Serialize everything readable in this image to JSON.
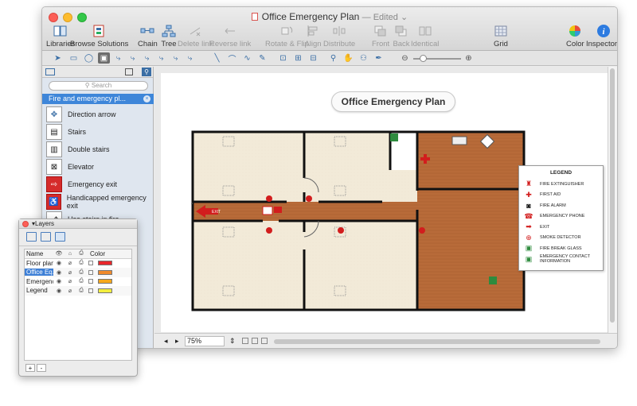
{
  "window": {
    "title": "Office Emergency Plan",
    "status": "Edited",
    "status_caret": "⌄"
  },
  "toolbar": [
    {
      "label": "Libraries",
      "icon": "libraries-icon",
      "enabled": true
    },
    {
      "label": "Browse Solutions",
      "icon": "browse-solutions-icon",
      "enabled": true
    },
    {
      "label": "Chain",
      "icon": "chain-icon",
      "enabled": true
    },
    {
      "label": "Tree",
      "icon": "tree-icon",
      "enabled": true
    },
    {
      "label": "Delete link",
      "icon": "delete-link-icon",
      "enabled": false
    },
    {
      "label": "Reverse link",
      "icon": "reverse-link-icon",
      "enabled": false
    },
    {
      "label": "Rotate & Flip",
      "icon": "rotate-flip-icon",
      "enabled": false
    },
    {
      "label": "Align",
      "icon": "align-icon",
      "enabled": false
    },
    {
      "label": "Distribute",
      "icon": "distribute-icon",
      "enabled": false
    },
    {
      "label": "Front",
      "icon": "front-icon",
      "enabled": false
    },
    {
      "label": "Back",
      "icon": "back-icon",
      "enabled": false
    },
    {
      "label": "Identical",
      "icon": "identical-icon",
      "enabled": false
    },
    {
      "label": "Grid",
      "icon": "grid-icon",
      "enabled": true
    },
    {
      "label": "Color",
      "icon": "color-wheel-icon",
      "enabled": true
    },
    {
      "label": "Inspectors",
      "icon": "info-icon",
      "enabled": true
    }
  ],
  "sidebar": {
    "search_placeholder": "Search",
    "library_title": "Fire and emergency pl...",
    "items": [
      {
        "label": "Direction arrow",
        "icon": "direction-arrow-icon"
      },
      {
        "label": "Stairs",
        "icon": "stairs-icon"
      },
      {
        "label": "Double stairs",
        "icon": "double-stairs-icon"
      },
      {
        "label": "Elevator",
        "icon": "elevator-icon"
      },
      {
        "label": "Emergency exit",
        "icon": "emergency-exit-icon"
      },
      {
        "label": "Handicapped emergency exit",
        "icon": "handicapped-exit-icon"
      },
      {
        "label": "Use stairs in fire",
        "icon": "use-stairs-icon"
      }
    ]
  },
  "canvas": {
    "diagram_title": "Office Emergency Plan",
    "exit_sign": "EXIT"
  },
  "legend": {
    "title": "LEGEND",
    "items": [
      {
        "label": "FIRE EXTINGUISHER",
        "icon": "fire-extinguisher-icon"
      },
      {
        "label": "FIRST AID",
        "icon": "first-aid-icon"
      },
      {
        "label": "FIRE ALARM",
        "icon": "fire-alarm-icon"
      },
      {
        "label": "EMERGENCY PHONE",
        "icon": "emergency-phone-icon"
      },
      {
        "label": "EXIT",
        "icon": "exit-arrow-icon"
      },
      {
        "label": "SMOKE DETECTOR",
        "icon": "smoke-detector-icon"
      },
      {
        "label": "FIRE BREAK GLASS",
        "icon": "fire-break-glass-icon"
      },
      {
        "label": "EMERGENCY CONTACT INFORMATION",
        "icon": "emergency-contact-icon"
      }
    ]
  },
  "statusbar": {
    "zoom": "75%"
  },
  "layers": {
    "title": "Layers",
    "header": {
      "name": "Name",
      "color": "Color"
    },
    "rows": [
      {
        "name": "Floor plan",
        "color": "#e8262b",
        "selected": false
      },
      {
        "name": "Office Eq...",
        "color": "#f08a2c",
        "selected": true
      },
      {
        "name": "Emergenc...",
        "color": "#f6a81c",
        "selected": false
      },
      {
        "name": "Legend",
        "color": "#f3ee3e",
        "selected": false
      }
    ],
    "add_button": "+",
    "remove_button": "-"
  }
}
